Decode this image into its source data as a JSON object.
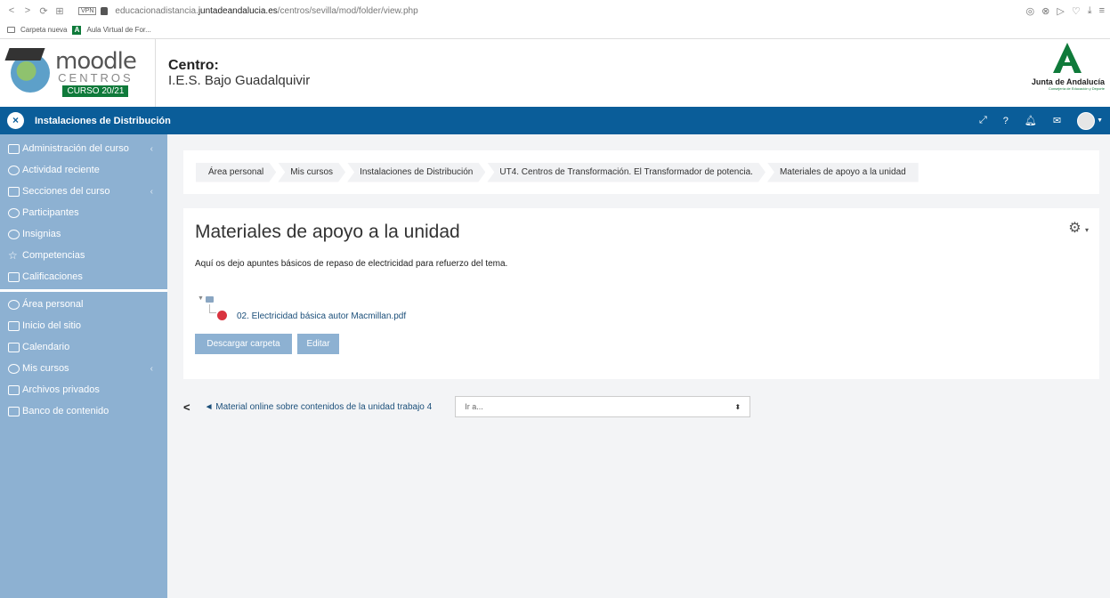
{
  "browser": {
    "url_prefix": "educacionadistancia.",
    "url_domain": "juntadeandalucia.es",
    "url_path": "/centros/sevilla/mod/folder/view.php",
    "vpn_label": "VPN",
    "bookmarks": [
      {
        "label": "Carpeta nueva"
      },
      {
        "label": "Aula Virtual de For..."
      }
    ]
  },
  "header": {
    "logo_moodle": "moodle",
    "logo_centros": "CENTROS",
    "logo_curso": "CURSO 20/21",
    "centro_label": "Centro:",
    "centro_name": "I.E.S. Bajo Guadalquivir",
    "junta_name": "Junta de Andalucía",
    "junta_sub": "Consejería de Educación y Deporte"
  },
  "topbar": {
    "course_title": "Instalaciones de Distribución"
  },
  "sidebar": {
    "items": [
      {
        "label": "Administración del curso",
        "chevron": "‹"
      },
      {
        "label": "Actividad reciente"
      },
      {
        "label": "Secciones del curso",
        "chevron": "‹"
      },
      {
        "label": "Participantes"
      },
      {
        "label": "Insignias"
      },
      {
        "label": "Competencias"
      },
      {
        "label": "Calificaciones"
      },
      {
        "label": "Área personal"
      },
      {
        "label": "Inicio del sitio"
      },
      {
        "label": "Calendario"
      },
      {
        "label": "Mis cursos",
        "chevron": "‹"
      },
      {
        "label": "Archivos privados"
      },
      {
        "label": "Banco de contenido"
      }
    ]
  },
  "breadcrumb": [
    "Área personal",
    "Mis cursos",
    "Instalaciones de Distribución",
    "UT4. Centros de Transformación. El Transformador de potencia.",
    "Materiales de apoyo a la unidad"
  ],
  "page": {
    "title": "Materiales de apoyo a la unidad",
    "intro": "Aquí os dejo apuntes básicos de repaso de electricidad para refuerzo del tema.",
    "file_name": "02. Electricidad básica autor Macmillan.pdf",
    "download_button": "Descargar carpeta",
    "edit_button": "Editar"
  },
  "navigation": {
    "prev_link": "◄ Material online sobre contenidos de la unidad trabajo 4",
    "jump_placeholder": "Ir a..."
  }
}
